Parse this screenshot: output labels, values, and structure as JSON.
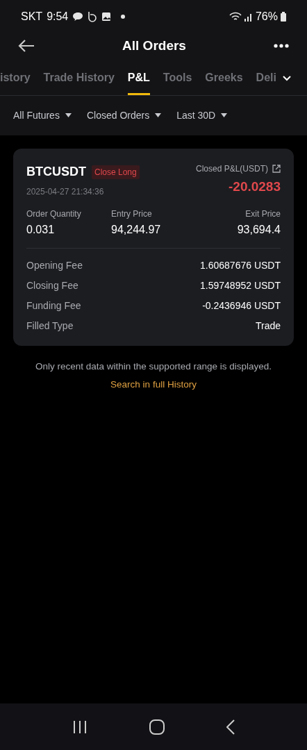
{
  "status_bar": {
    "carrier": "SKT",
    "time": "9:54",
    "battery": "76%"
  },
  "header": {
    "title": "All Orders"
  },
  "tabs": [
    {
      "label": "istory",
      "selected": false
    },
    {
      "label": "Trade History",
      "selected": false
    },
    {
      "label": "P&L",
      "selected": true
    },
    {
      "label": "Tools",
      "selected": false
    },
    {
      "label": "Greeks",
      "selected": false
    },
    {
      "label": "Deli",
      "selected": false
    }
  ],
  "filters": [
    "All Futures",
    "Closed Orders",
    "Last 30D"
  ],
  "order": {
    "symbol": "BTCUSDT",
    "side_tag": "Close Long",
    "time": "2025-04-27 21:34:36",
    "pnl_label": "Closed P&L(USDT)",
    "pnl": "-20.0283",
    "stats": [
      {
        "label": "Order Quantity",
        "value": "0.031"
      },
      {
        "label": "Entry Price",
        "value": "94,244.97"
      },
      {
        "label": "Exit Price",
        "value": "93,694.4"
      }
    ],
    "details": [
      {
        "label": "Opening Fee",
        "value": "1.60687676 USDT"
      },
      {
        "label": "Closing Fee",
        "value": "1.59748952 USDT"
      },
      {
        "label": "Funding Fee",
        "value": "-0.2436946 USDT"
      },
      {
        "label": "Filled Type",
        "value": "Trade"
      }
    ]
  },
  "notice": "Only recent data within the supported range is displayed.",
  "link": "Search in full History"
}
